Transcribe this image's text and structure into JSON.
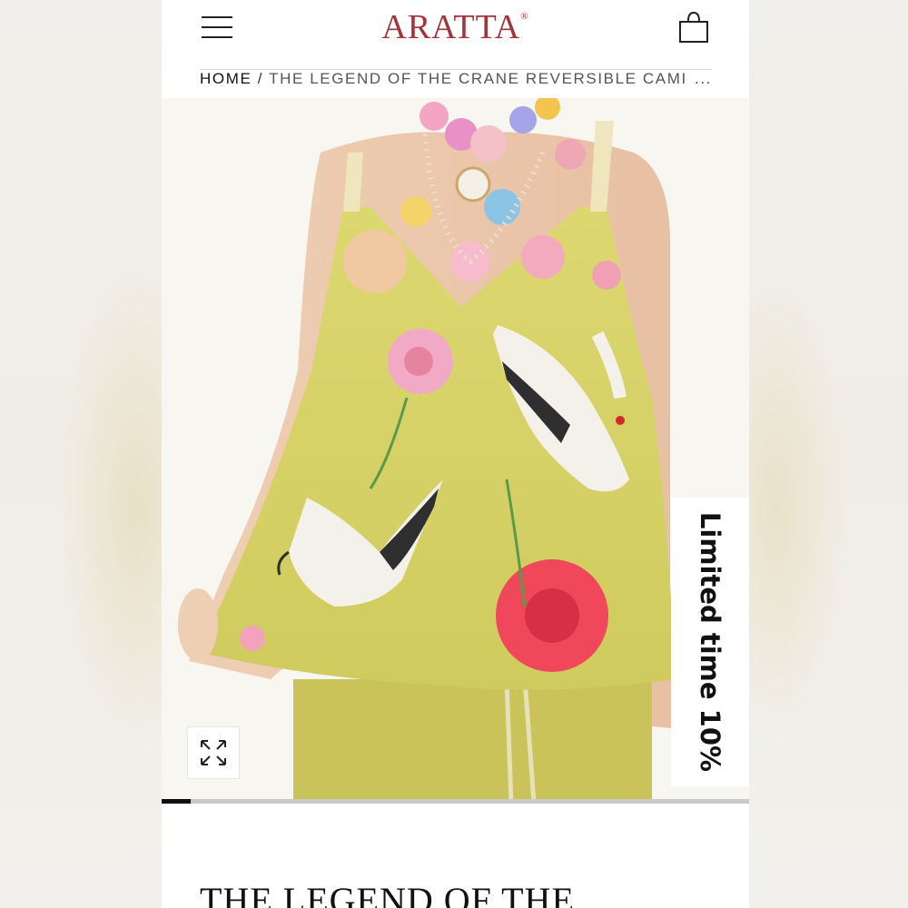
{
  "header": {
    "brand": "ARATTA",
    "brand_mark": "®",
    "menu_icon": "hamburger-menu-icon",
    "bag_icon": "shopping-bag-icon"
  },
  "breadcrumb": {
    "home": "HOME",
    "separator": "/",
    "current": "THE LEGEND OF THE CRANE REVERSIBLE CAMI",
    "ellipsis": "..."
  },
  "gallery": {
    "promo_label": "Limited time 10%",
    "zoom_icon": "expand-arrows-icon",
    "slide_progress": 0.05
  },
  "product": {
    "title": "THE LEGEND OF THE"
  },
  "colors": {
    "brand": "#a5333a",
    "garment": "#d9d66a",
    "progress": "#111111"
  }
}
